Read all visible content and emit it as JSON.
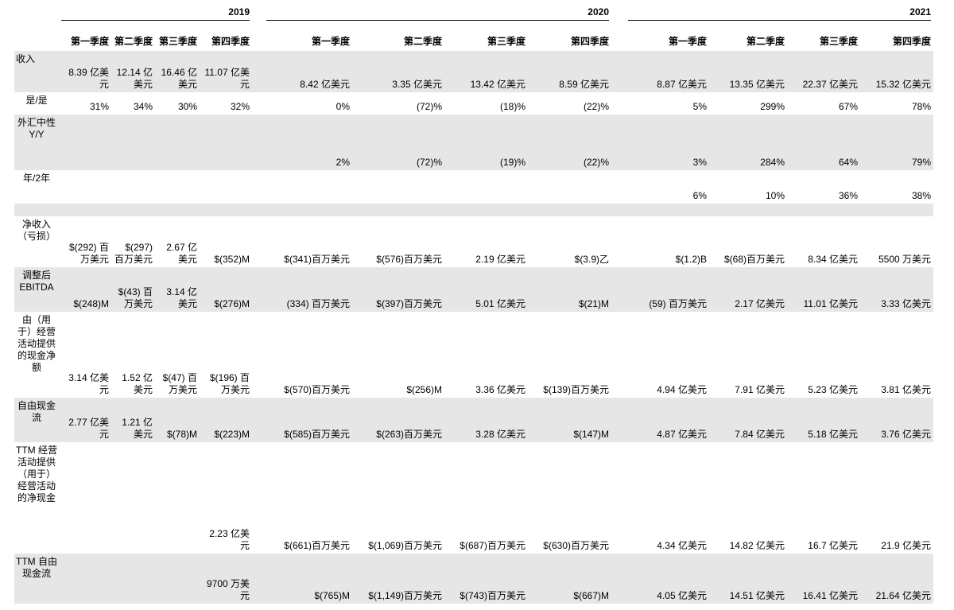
{
  "years": [
    "2019",
    "2020",
    "2021"
  ],
  "quarters": [
    "第一季度",
    "第二季度",
    "第三季度",
    "第四季度",
    "第一季度",
    "第二季度",
    "第三季度",
    "第四季度",
    "第一季度",
    "第二季度",
    "第三季度",
    "第四季度"
  ],
  "rows": [
    {
      "label": "收入",
      "shade": true,
      "h": 52,
      "labelAlign": "left",
      "values": [
        "8.39 亿美元",
        "12.14 亿美元",
        "16.46 亿美元",
        "11.07 亿美元",
        "8.42 亿美元",
        "3.35 亿美元",
        "13.42 亿美元",
        "8.59 亿美元",
        "8.87 亿美元",
        "13.35 亿美元",
        "22.37 亿美元",
        "15.32 亿美元"
      ]
    },
    {
      "label": "是/是",
      "shade": false,
      "h": 28,
      "values": [
        "31%",
        "34%",
        "30%",
        "32%",
        "0%",
        "(72)%",
        "(18)%",
        "(22)%",
        "5%",
        "299%",
        "67%",
        "78%"
      ]
    },
    {
      "label": "外汇中性Y/Y",
      "shade": true,
      "h": 70,
      "values": [
        "",
        "",
        "",
        "",
        "2%",
        "(72)%",
        "(19)%",
        "(22)%",
        "3%",
        "284%",
        "64%",
        "79%"
      ]
    },
    {
      "label": "年/2年",
      "shade": false,
      "h": 42,
      "values": [
        "",
        "",
        "",
        "",
        "",
        "",
        "",
        "",
        "6%",
        "10%",
        "36%",
        "38%"
      ]
    },
    {
      "label": "",
      "shade": true,
      "h": 16,
      "values": [
        "",
        "",
        "",
        "",
        "",
        "",
        "",
        "",
        "",
        "",
        "",
        ""
      ]
    },
    {
      "label": "净收入（亏损）",
      "shade": false,
      "h": 64,
      "values": [
        "$(292) 百万美元",
        "$(297) 百万美元",
        "2.67 亿美元",
        "$(352)M",
        "$(341)百万美元",
        "$(576)百万美元",
        "2.19 亿美元",
        "$(3.9)乙",
        "$(1.2)B",
        "$(68)百万美元",
        "8.34 亿美元",
        "5500 万美元"
      ]
    },
    {
      "label": "调整后EBITDA",
      "shade": true,
      "h": 56,
      "values": [
        "$(248)M",
        "$(43) 百万美元",
        "3.14 亿美元",
        "$(276)M",
        "(334) 百万美元",
        "$(397)百万美元",
        "5.01 亿美元",
        "$(21)M",
        "(59) 百万美元",
        "2.17 亿美元",
        "11.01 亿美元",
        "3.33 亿美元"
      ]
    },
    {
      "label": "由（用于）经营活动提供的现金净额",
      "shade": false,
      "h": 108,
      "values": [
        "3.14 亿美元",
        "1.52 亿美元",
        "$(47) 百万美元",
        "$(196) 百万美元",
        "$(570)百万美元",
        "$(256)M",
        "3.36 亿美元",
        "$(139)百万美元",
        "4.94 亿美元",
        "7.91 亿美元",
        "5.23 亿美元",
        "3.81 亿美元"
      ]
    },
    {
      "label": "自由现金流",
      "shade": true,
      "h": 56,
      "values": [
        "2.77 亿美元",
        "1.21 亿美元",
        "$(78)M",
        "$(223)M",
        "$(585)百万美元",
        "$(263)百万美元",
        "3.28 亿美元",
        "$(147)M",
        "4.87 亿美元",
        "7.84 亿美元",
        "5.18 亿美元",
        "3.76 亿美元"
      ]
    },
    {
      "label": "TTM 经营活动提供（用于）经营活动的净现金",
      "shade": false,
      "h": 140,
      "values": [
        "",
        "",
        "",
        "2.23 亿美元",
        "$(661)百万美元",
        "$(1,069)百万美元",
        "$(687)百万美元",
        "$(630)百万美元",
        "4.34 亿美元",
        "14.82 亿美元",
        "16.7 亿美元",
        "21.9 亿美元"
      ]
    },
    {
      "label": "TTM 自由现金流",
      "shade": true,
      "h": 63,
      "values": [
        "",
        "",
        "",
        "9700 万美元",
        "$(765)M",
        "$(1,149)百万美元",
        "$(743)百万美元",
        "$(667)M",
        "4.05 亿美元",
        "14.51 亿美元",
        "16.41 亿美元",
        "21.64 亿美元"
      ]
    }
  ]
}
